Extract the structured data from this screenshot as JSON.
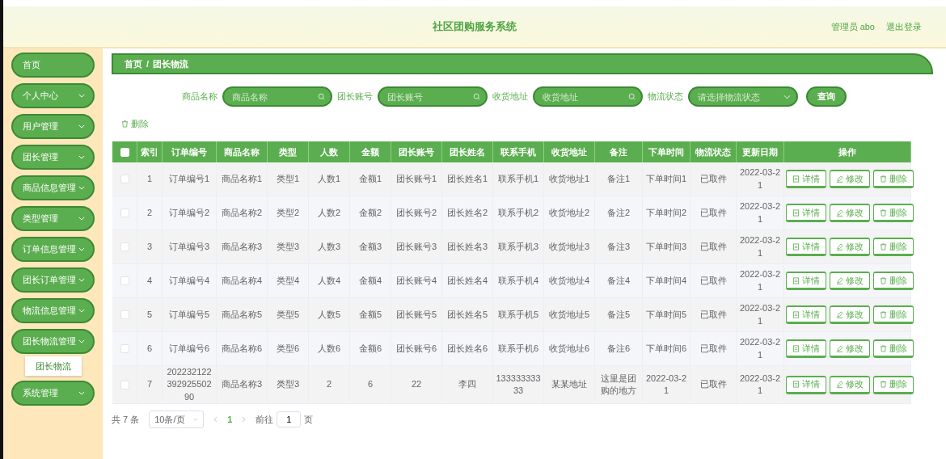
{
  "header": {
    "title": "社区团购服务系统",
    "user": "管理员 abo",
    "logout": "退出登录"
  },
  "sidebar": {
    "items": [
      {
        "label": "首页",
        "kind": "link"
      },
      {
        "label": "个人中心",
        "kind": "menu"
      },
      {
        "label": "用户管理",
        "kind": "menu"
      },
      {
        "label": "团长管理",
        "kind": "menu"
      },
      {
        "label": "商品信息管理",
        "kind": "menu"
      },
      {
        "label": "类型管理",
        "kind": "menu"
      },
      {
        "label": "订单信息管理",
        "kind": "menu"
      },
      {
        "label": "团长订单管理",
        "kind": "menu"
      },
      {
        "label": "物流信息管理",
        "kind": "menu"
      },
      {
        "label": "团长物流管理",
        "kind": "menu",
        "children": [
          {
            "label": "团长物流",
            "selected": true
          }
        ]
      },
      {
        "label": "系统管理",
        "kind": "menu"
      }
    ]
  },
  "breadcrumb": [
    "首页",
    "/",
    "团长物流"
  ],
  "filters": [
    {
      "label": "商品名称",
      "placeholder": "商品名称",
      "kind": "search"
    },
    {
      "label": "团长账号",
      "placeholder": "团长账号",
      "kind": "search"
    },
    {
      "label": "收货地址",
      "placeholder": "收货地址",
      "kind": "search"
    },
    {
      "label": "物流状态",
      "placeholder": "请选择物流状态",
      "kind": "select"
    }
  ],
  "search_button": "查询",
  "delete_button": "删除",
  "table": {
    "select_all": {
      "checked": false
    },
    "columns": [
      "索引",
      "订单编号",
      "商品名称",
      "类型",
      "人数",
      "金额",
      "团长账号",
      "团长姓名",
      "联系手机",
      "收货地址",
      "备注",
      "下单时间",
      "物流状态",
      "更新日期",
      "操作"
    ],
    "rows": [
      {
        "checked": false,
        "cells": [
          "1",
          "订单编号1",
          "商品名称1",
          "类型1",
          "人数1",
          "金额1",
          "团长账号1",
          "团长姓名1",
          "联系手机1",
          "收货地址1",
          "备注1",
          "下单时间1",
          "已取件",
          "2022-03-21"
        ],
        "actions": [
          "详情",
          "修改",
          "删除"
        ]
      },
      {
        "checked": false,
        "cells": [
          "2",
          "订单编号2",
          "商品名称2",
          "类型2",
          "人数2",
          "金额2",
          "团长账号2",
          "团长姓名2",
          "联系手机2",
          "收货地址2",
          "备注2",
          "下单时间2",
          "已取件",
          "2022-03-21"
        ],
        "actions": [
          "详情",
          "修改",
          "删除"
        ]
      },
      {
        "checked": false,
        "cells": [
          "3",
          "订单编号3",
          "商品名称3",
          "类型3",
          "人数3",
          "金额3",
          "团长账号3",
          "团长姓名3",
          "联系手机3",
          "收货地址3",
          "备注3",
          "下单时间3",
          "已取件",
          "2022-03-21"
        ],
        "actions": [
          "详情",
          "修改",
          "删除"
        ]
      },
      {
        "checked": false,
        "cells": [
          "4",
          "订单编号4",
          "商品名称4",
          "类型4",
          "人数4",
          "金额4",
          "团长账号4",
          "团长姓名4",
          "联系手机4",
          "收货地址4",
          "备注4",
          "下单时间4",
          "已取件",
          "2022-03-21"
        ],
        "actions": [
          "详情",
          "修改",
          "删除"
        ]
      },
      {
        "checked": false,
        "cells": [
          "5",
          "订单编号5",
          "商品名称5",
          "类型5",
          "人数5",
          "金额5",
          "团长账号5",
          "团长姓名5",
          "联系手机5",
          "收货地址5",
          "备注5",
          "下单时间5",
          "已取件",
          "2022-03-21"
        ],
        "actions": [
          "详情",
          "修改",
          "删除"
        ]
      },
      {
        "checked": false,
        "cells": [
          "6",
          "订单编号6",
          "商品名称6",
          "类型6",
          "人数6",
          "金额6",
          "团长账号6",
          "团长姓名6",
          "联系手机6",
          "收货地址6",
          "备注6",
          "下单时间6",
          "已取件",
          "2022-03-21"
        ],
        "actions": [
          "详情",
          "修改",
          "删除"
        ]
      },
      {
        "checked": false,
        "cells": [
          "7",
          "20223212239292550290",
          "商品名称3",
          "类型3",
          "2",
          "6",
          "22",
          "李四",
          "13333333333",
          "某某地址",
          "这里是团购的地方",
          "2022-03-21",
          "已取件",
          "2022-03-21"
        ],
        "actions": [
          "详情",
          "修改",
          "删除"
        ]
      }
    ]
  },
  "pagination": {
    "total": "共 7 条",
    "page_size": "10条/页",
    "pages": [
      {
        "label": "1",
        "selected": true
      }
    ],
    "goto_label": "前往",
    "goto_value": "1",
    "goto_suffix": "页"
  }
}
